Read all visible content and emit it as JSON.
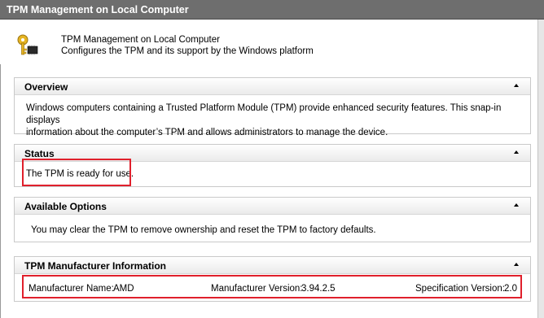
{
  "window": {
    "title": "TPM Management on Local Computer"
  },
  "header": {
    "icon": "key-chip-icon",
    "title": "TPM Management on Local Computer",
    "subtitle": "Configures the TPM and its support by the Windows platform"
  },
  "sections": {
    "overview": {
      "title": "Overview",
      "line1": "Windows computers containing a Trusted Platform Module (TPM) provide enhanced security features. This snap-in displays",
      "line2": "information about the computer’s TPM and allows administrators to manage the device."
    },
    "status": {
      "title": "Status",
      "text": "The TPM is ready for use."
    },
    "options": {
      "title": "Available Options",
      "text": "You may clear the TPM to remove ownership and reset the TPM to factory defaults."
    },
    "manufacturer": {
      "title": "TPM Manufacturer Information",
      "name_label": "Manufacturer Name:",
      "name_value": "AMD",
      "version_label": "Manufacturer Version:",
      "version_value": "3.94.2.5",
      "spec_label": "Specification Version:",
      "spec_value": "2.0"
    }
  },
  "colors": {
    "titlebar": "#6e6e6e",
    "highlight": "#e0202c",
    "section_border": "#c9c9c9"
  }
}
